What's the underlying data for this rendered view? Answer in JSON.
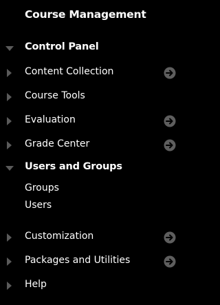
{
  "panel": {
    "title": "Course Management",
    "colors": {
      "background": "#000000",
      "text": "#ffffff",
      "triangle": "#5a5a5a",
      "arrow_bg": "#5e5e5e",
      "arrow_fg": "#000000"
    },
    "sections": [
      {
        "label": "Control Panel",
        "state": "expanded",
        "has_arrow": false,
        "icon": "triangle-down-icon"
      },
      {
        "label": "Content Collection",
        "state": "collapsed",
        "has_arrow": true,
        "icon": "triangle-right-icon"
      },
      {
        "label": "Course Tools",
        "state": "collapsed",
        "has_arrow": false,
        "icon": "triangle-right-icon"
      },
      {
        "label": "Evaluation",
        "state": "collapsed",
        "has_arrow": true,
        "icon": "triangle-right-icon"
      },
      {
        "label": "Grade Center",
        "state": "collapsed",
        "has_arrow": true,
        "icon": "triangle-right-icon"
      },
      {
        "label": "Users and Groups",
        "state": "expanded",
        "has_arrow": false,
        "icon": "triangle-down-icon"
      },
      {
        "label": "Customization",
        "state": "collapsed",
        "has_arrow": true,
        "icon": "triangle-right-icon"
      },
      {
        "label": "Packages and Utilities",
        "state": "collapsed",
        "has_arrow": true,
        "icon": "triangle-right-icon"
      },
      {
        "label": "Help",
        "state": "collapsed",
        "has_arrow": false,
        "icon": "triangle-right-icon"
      }
    ],
    "users_and_groups_items": [
      {
        "label": "Groups"
      },
      {
        "label": "Users"
      }
    ],
    "arrow_icon": "arrow-right-circle-icon"
  }
}
